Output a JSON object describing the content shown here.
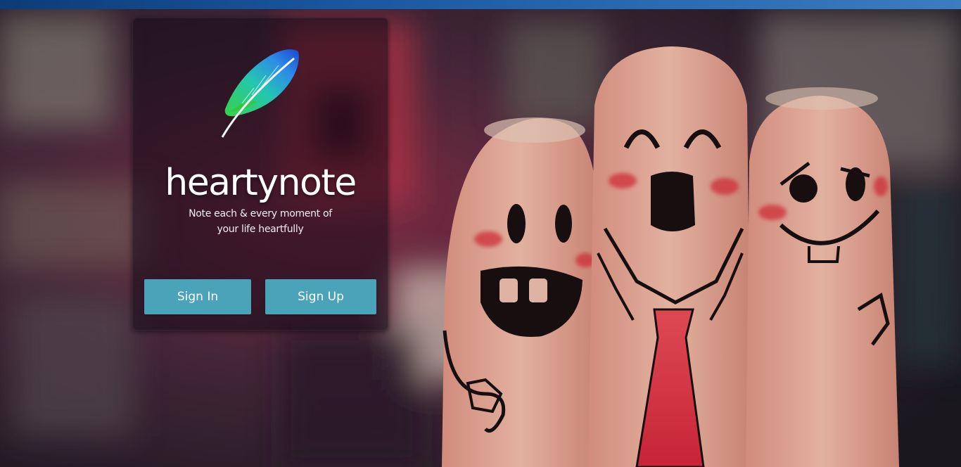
{
  "colors": {
    "top_bar": "#1b5aa3",
    "button_bg": "#4aa3b8",
    "button_text": "#ffffff",
    "card_bg": "rgba(20,10,22,0.55)"
  },
  "background": {
    "icon": "finger-faces-photo"
  },
  "card": {
    "logo_icon": "feather-icon",
    "brand": "heartynote",
    "tagline_line1": "Note each & every moment of",
    "tagline_line2": "your life heartfully"
  },
  "buttons": {
    "signin_label": "Sign In",
    "signup_label": "Sign Up"
  }
}
